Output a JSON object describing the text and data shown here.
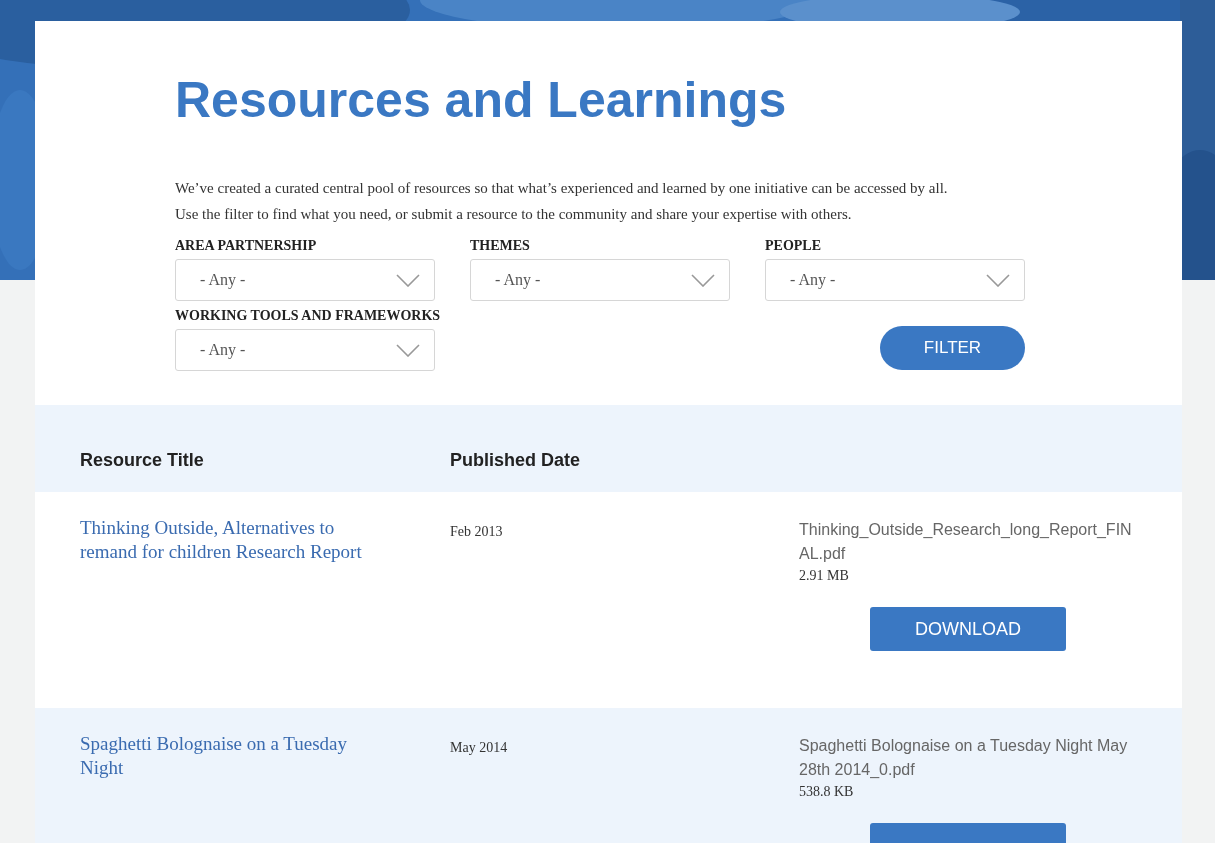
{
  "page": {
    "title": "Resources and Learnings",
    "intro": [
      "We’ve created a curated central pool of resources so that what’s experienced and learned by one initiative can be accessed by all.",
      "Use the filter to find what you need, or submit a resource to the community and share your expertise with others."
    ]
  },
  "filters": [
    {
      "label": "AREA PARTNERSHIP",
      "value": "- Any -"
    },
    {
      "label": "THEMES",
      "value": "- Any -"
    },
    {
      "label": "PEOPLE",
      "value": "- Any -"
    },
    {
      "label": "WORKING TOOLS AND FRAMEWORKS",
      "value": "- Any -"
    }
  ],
  "filter_button": "FILTER",
  "table": {
    "columns": [
      "Resource Title",
      "Published Date"
    ],
    "rows": [
      {
        "title": "Thinking Outside, Alternatives to remand for children Research Report",
        "date": "Feb 2013",
        "file_name": "Thinking_Outside_Research_long_Report_FINAL.pdf",
        "file_size": "2.91 MB",
        "button": "DOWNLOAD"
      },
      {
        "title": "Spaghetti Bolognaise on a Tuesday Night",
        "date": "May 2014",
        "file_name": "Spaghetti Bolognaise on a Tuesday Night May 28th 2014_0.pdf",
        "file_size": "538.8 KB"
      }
    ]
  }
}
